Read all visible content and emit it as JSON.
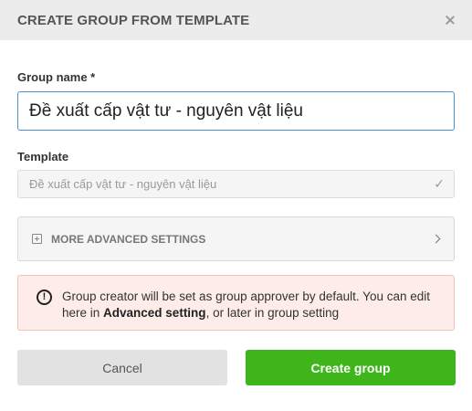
{
  "dialog": {
    "title": "CREATE GROUP FROM TEMPLATE"
  },
  "group_name": {
    "label": "Group name *",
    "value": "Đề xuất cấp vật tư - nguyên vật liệu"
  },
  "template": {
    "label": "Template",
    "value": "Đề xuất cấp vật tư - nguyên vật liệu"
  },
  "advanced": {
    "label": "MORE ADVANCED SETTINGS"
  },
  "notice": {
    "text_before": "Group creator will be set as group approver by default. You can edit here in ",
    "link_text": "Advanced setting",
    "text_after": ", or later in group setting"
  },
  "buttons": {
    "cancel": "Cancel",
    "create": "Create group"
  },
  "icons": {
    "close": "close-icon",
    "check": "check-icon",
    "plus_box": "plus-box-icon",
    "chevron": "chevron-right-icon",
    "info": "info-icon"
  },
  "colors": {
    "primary_green": "#3db51b",
    "focus_blue": "#4a90d9",
    "notice_bg": "#fdece8"
  }
}
